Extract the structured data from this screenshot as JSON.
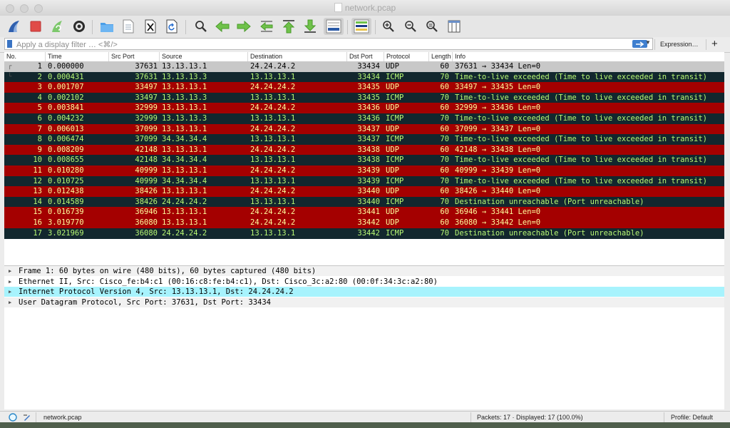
{
  "window": {
    "title": "network.pcap"
  },
  "toolbar": {
    "buttons": [
      {
        "icon": "shark-fin-start-icon"
      },
      {
        "icon": "stop-capture-icon"
      },
      {
        "icon": "restart-capture-icon"
      },
      {
        "icon": "capture-options-gear-icon"
      },
      {
        "icon": "open-folder-icon"
      },
      {
        "icon": "save-file-icon"
      },
      {
        "icon": "close-file-icon"
      },
      {
        "icon": "reload-file-icon"
      },
      {
        "icon": "find-packet-icon"
      },
      {
        "icon": "go-back-arrow-icon"
      },
      {
        "icon": "go-forward-arrow-icon"
      },
      {
        "icon": "go-to-packet-icon"
      },
      {
        "icon": "go-to-first-packet-icon"
      },
      {
        "icon": "go-to-last-packet-icon"
      },
      {
        "icon": "auto-scroll-icon"
      },
      {
        "icon": "colorize-list-icon"
      },
      {
        "icon": "zoom-in-icon"
      },
      {
        "icon": "zoom-out-icon"
      },
      {
        "icon": "normal-size-icon"
      },
      {
        "icon": "resize-columns-icon"
      }
    ]
  },
  "filter": {
    "placeholder": "Apply a display filter … <⌘/>",
    "expression_label": "Expression…",
    "add_label": "+"
  },
  "packet_list": {
    "columns": [
      "No.",
      "Time",
      "Src Port",
      "Source",
      "Destination",
      "Dst Port",
      "Protocol",
      "Length",
      "Info"
    ],
    "rows": [
      {
        "no": "1",
        "time": "0.000000",
        "src_port": "37631",
        "source": "13.13.13.1",
        "destination": "24.24.24.2",
        "dst_port": "33434",
        "protocol": "UDP",
        "length": "60",
        "info": "37631 → 33434 Len=0",
        "style": "selected"
      },
      {
        "no": "2",
        "time": "0.000431",
        "src_port": "37631",
        "source": "13.13.13.3",
        "destination": "13.13.13.1",
        "dst_port": "33434",
        "protocol": "ICMP",
        "length": "70",
        "info": "Time-to-live exceeded (Time to live exceeded in transit)",
        "style": "icmp"
      },
      {
        "no": "3",
        "time": "0.001707",
        "src_port": "33497",
        "source": "13.13.13.1",
        "destination": "24.24.24.2",
        "dst_port": "33435",
        "protocol": "UDP",
        "length": "60",
        "info": "33497 → 33435 Len=0",
        "style": "udp"
      },
      {
        "no": "4",
        "time": "0.002102",
        "src_port": "33497",
        "source": "13.13.13.3",
        "destination": "13.13.13.1",
        "dst_port": "33435",
        "protocol": "ICMP",
        "length": "70",
        "info": "Time-to-live exceeded (Time to live exceeded in transit)",
        "style": "icmp"
      },
      {
        "no": "5",
        "time": "0.003841",
        "src_port": "32999",
        "source": "13.13.13.1",
        "destination": "24.24.24.2",
        "dst_port": "33436",
        "protocol": "UDP",
        "length": "60",
        "info": "32999 → 33436 Len=0",
        "style": "udp"
      },
      {
        "no": "6",
        "time": "0.004232",
        "src_port": "32999",
        "source": "13.13.13.3",
        "destination": "13.13.13.1",
        "dst_port": "33436",
        "protocol": "ICMP",
        "length": "70",
        "info": "Time-to-live exceeded (Time to live exceeded in transit)",
        "style": "icmp"
      },
      {
        "no": "7",
        "time": "0.006013",
        "src_port": "37099",
        "source": "13.13.13.1",
        "destination": "24.24.24.2",
        "dst_port": "33437",
        "protocol": "UDP",
        "length": "60",
        "info": "37099 → 33437 Len=0",
        "style": "udp"
      },
      {
        "no": "8",
        "time": "0.006474",
        "src_port": "37099",
        "source": "34.34.34.4",
        "destination": "13.13.13.1",
        "dst_port": "33437",
        "protocol": "ICMP",
        "length": "70",
        "info": "Time-to-live exceeded (Time to live exceeded in transit)",
        "style": "icmp"
      },
      {
        "no": "9",
        "time": "0.008209",
        "src_port": "42148",
        "source": "13.13.13.1",
        "destination": "24.24.24.2",
        "dst_port": "33438",
        "protocol": "UDP",
        "length": "60",
        "info": "42148 → 33438 Len=0",
        "style": "udp"
      },
      {
        "no": "10",
        "time": "0.008655",
        "src_port": "42148",
        "source": "34.34.34.4",
        "destination": "13.13.13.1",
        "dst_port": "33438",
        "protocol": "ICMP",
        "length": "70",
        "info": "Time-to-live exceeded (Time to live exceeded in transit)",
        "style": "icmp"
      },
      {
        "no": "11",
        "time": "0.010280",
        "src_port": "40999",
        "source": "13.13.13.1",
        "destination": "24.24.24.2",
        "dst_port": "33439",
        "protocol": "UDP",
        "length": "60",
        "info": "40999 → 33439 Len=0",
        "style": "udp"
      },
      {
        "no": "12",
        "time": "0.010725",
        "src_port": "40999",
        "source": "34.34.34.4",
        "destination": "13.13.13.1",
        "dst_port": "33439",
        "protocol": "ICMP",
        "length": "70",
        "info": "Time-to-live exceeded (Time to live exceeded in transit)",
        "style": "icmp"
      },
      {
        "no": "13",
        "time": "0.012438",
        "src_port": "38426",
        "source": "13.13.13.1",
        "destination": "24.24.24.2",
        "dst_port": "33440",
        "protocol": "UDP",
        "length": "60",
        "info": "38426 → 33440 Len=0",
        "style": "udp"
      },
      {
        "no": "14",
        "time": "0.014589",
        "src_port": "38426",
        "source": "24.24.24.2",
        "destination": "13.13.13.1",
        "dst_port": "33440",
        "protocol": "ICMP",
        "length": "70",
        "info": "Destination unreachable (Port unreachable)",
        "style": "icmp"
      },
      {
        "no": "15",
        "time": "0.016739",
        "src_port": "36946",
        "source": "13.13.13.1",
        "destination": "24.24.24.2",
        "dst_port": "33441",
        "protocol": "UDP",
        "length": "60",
        "info": "36946 → 33441 Len=0",
        "style": "udp"
      },
      {
        "no": "16",
        "time": "3.019770",
        "src_port": "36080",
        "source": "13.13.13.1",
        "destination": "24.24.24.2",
        "dst_port": "33442",
        "protocol": "UDP",
        "length": "60",
        "info": "36080 → 33442 Len=0",
        "style": "udp"
      },
      {
        "no": "17",
        "time": "3.021969",
        "src_port": "36080",
        "source": "24.24.24.2",
        "destination": "13.13.13.1",
        "dst_port": "33442",
        "protocol": "ICMP",
        "length": "70",
        "info": "Destination unreachable (Port unreachable)",
        "style": "icmp"
      }
    ]
  },
  "details": {
    "rows": [
      {
        "text": "Frame 1: 60 bytes on wire (480 bits), 60 bytes captured (480 bits)",
        "style": "alt"
      },
      {
        "text": "Ethernet II, Src: Cisco_fe:b4:c1 (00:16:c8:fe:b4:c1), Dst: Cisco_3c:a2:80 (00:0f:34:3c:a2:80)",
        "style": "normal"
      },
      {
        "text": "Internet Protocol Version 4, Src: 13.13.13.1, Dst: 24.24.24.2",
        "style": "hl"
      },
      {
        "text": "User Datagram Protocol, Src Port: 37631, Dst Port: 33434",
        "style": "alt"
      }
    ]
  },
  "status": {
    "file": "network.pcap",
    "packets": "Packets: 17 · Displayed: 17 (100.0%)",
    "profile": "Profile: Default"
  },
  "colors": {
    "udp_bg": "#a40000",
    "udp_fg": "#fffc9c",
    "icmp_bg": "#12272e",
    "icmp_fg": "#b7f774",
    "selected_bg": "#c8c8c8",
    "selected_fg": "#000000",
    "highlight": "#a7f3fd"
  }
}
